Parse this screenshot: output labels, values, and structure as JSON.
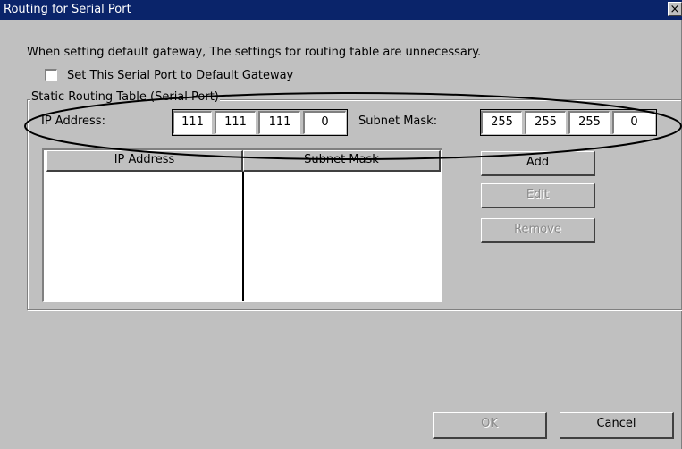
{
  "window": {
    "title": "Routing for Serial Port",
    "close_glyph": "×"
  },
  "notice": "When setting default gateway, The settings for routing table are unnecessary.",
  "default_gateway": {
    "label": "Set This Serial Port to Default Gateway",
    "checked": false
  },
  "static_routing": {
    "group_title": "Static Routing Table (Serial Port)",
    "ip_label": "IP Address:",
    "ip_octets": [
      "111",
      "111",
      "111",
      "0"
    ],
    "mask_label": "Subnet Mask:",
    "mask_octets": [
      "255",
      "255",
      "255",
      "0"
    ],
    "columns": [
      "IP Address",
      "Subnet Mask"
    ],
    "rows": [],
    "buttons": {
      "add": "Add",
      "edit": "Edit",
      "remove": "Remove"
    }
  },
  "footer": {
    "ok": "OK",
    "cancel": "Cancel"
  },
  "colors": {
    "titlebar": "#0a246a",
    "face": "#c0c0c0",
    "annotation": "#000000"
  }
}
